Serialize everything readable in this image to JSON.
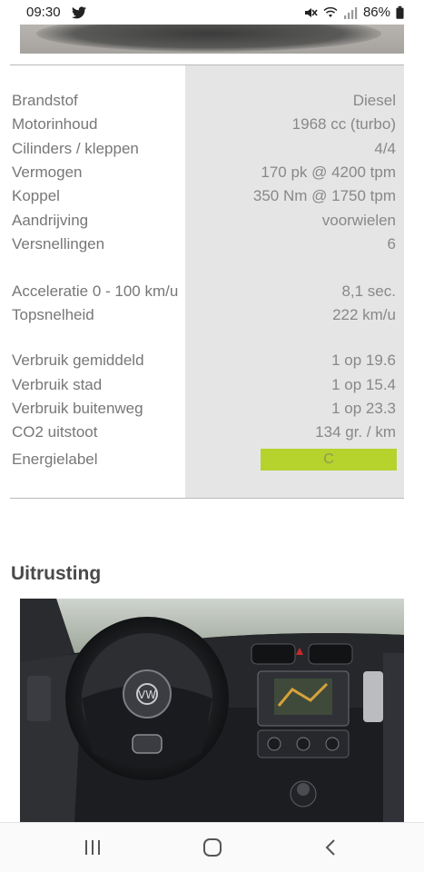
{
  "status": {
    "time": "09:30",
    "battery": "86%"
  },
  "specs": [
    {
      "label": "Brandstof",
      "value": "Diesel"
    },
    {
      "label": "Motorinhoud",
      "value": "1968 cc (turbo)"
    },
    {
      "label": "Cilinders / kleppen",
      "value": "4/4"
    },
    {
      "label": "Vermogen",
      "value": "170 pk @ 4200 tpm"
    },
    {
      "label": "Koppel",
      "value": "350 Nm @ 1750 tpm"
    },
    {
      "label": "Aandrijving",
      "value": "voorwielen"
    },
    {
      "label": "Versnellingen",
      "value": "6"
    },
    {
      "label": "Acceleratie 0 - 100 km/u",
      "value": "8,1 sec."
    },
    {
      "label": "Topsnelheid",
      "value": "222 km/u"
    },
    {
      "label": "Verbruik gemiddeld",
      "value": "1 op 19.6"
    },
    {
      "label": "Verbruik stad",
      "value": "1 op 15.4"
    },
    {
      "label": "Verbruik buitenweg",
      "value": "1 op 23.3"
    },
    {
      "label": "CO2 uitstoot",
      "value": "134 gr. / km"
    },
    {
      "label": "Energielabel",
      "value": "C"
    }
  ],
  "energy_label_color": "#b5d22d",
  "section": {
    "title": "Uitrusting"
  },
  "nav": {
    "recent_icon": "recent-apps-icon",
    "home_icon": "home-icon",
    "back_icon": "back-icon"
  }
}
